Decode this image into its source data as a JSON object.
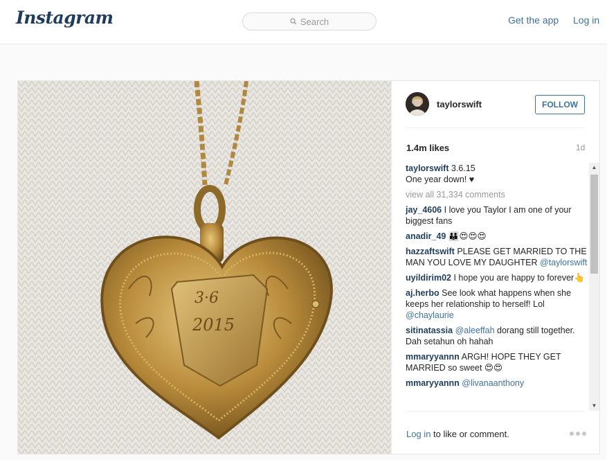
{
  "header": {
    "logo": "Instagram",
    "search_placeholder": "Search",
    "get_app": "Get the app",
    "login": "Log in"
  },
  "post": {
    "author": "taylorswift",
    "follow_label": "FOLLOW",
    "likes": "1.4m likes",
    "age": "1d",
    "caption_user": "taylorswift",
    "caption_line1": "3.6.15",
    "caption_line2": "One year down! ♥",
    "view_all": "view all 31,334 comments",
    "comments": [
      {
        "user": "jay_4606",
        "text": "I love you Taylor I am one of your biggest fans"
      },
      {
        "user": "anadir_49",
        "text": "👪😍😍😍"
      },
      {
        "user": "hazzaftswift",
        "text": "PLEASE GET MARRIED TO THE MAN YOU LOVE MY DAUGHTER",
        "mention": "@taylorswift"
      },
      {
        "user": "uyildirim02",
        "text": "I hope you are happy to forever👆"
      },
      {
        "user": "aj.herbo",
        "text": "See look what happens when she keeps her relationship to herself! Lol",
        "mention": "@chaylaurie"
      },
      {
        "user": "sitinatassia",
        "mention_first": "@aleeffah",
        "text": "dorang still together. Dah setahun oh hahah"
      },
      {
        "user": "mmaryyannn",
        "text": "ARGH! HOPE THEY GET MARRIED so sweet 😍😍"
      },
      {
        "user": "mmaryyannn",
        "mention_first": "@livanaanthony",
        "text": ""
      }
    ],
    "footer_login": "Log in",
    "footer_rest": "to like or comment."
  },
  "icons": {
    "search": "search-icon",
    "more": "more-options-icon",
    "scroll_up": "scroll-up-icon",
    "scroll_down": "scroll-down-icon"
  },
  "colors": {
    "link": "#3f729b",
    "username": "#1f3d5a",
    "logo": "#1f3d5a"
  }
}
